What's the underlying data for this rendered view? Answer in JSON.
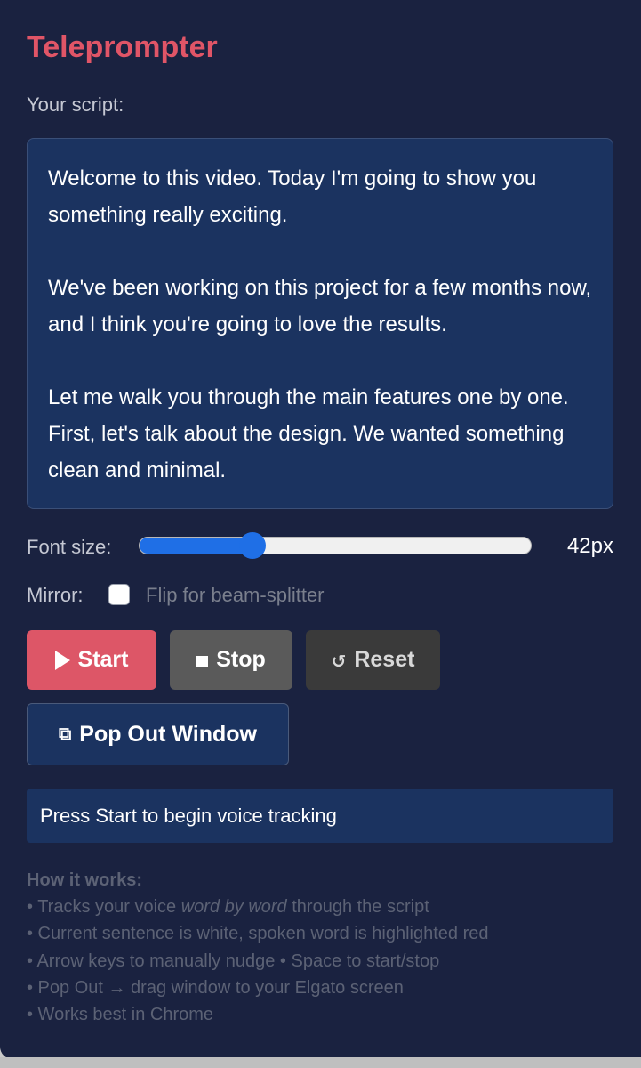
{
  "app": {
    "title": "Teleprompter"
  },
  "script": {
    "label": "Your script:",
    "text": "Welcome to this video. Today I'm going to show you something really exciting.\n\nWe've been working on this project for a few months now, and I think you're going to love the results.\n\nLet me walk you through the main features one by one. First, let's talk about the design. We wanted something clean and minimal."
  },
  "font_size": {
    "label": "Font size:",
    "value_label": "42px",
    "value": 42,
    "slider_fraction": 0.29
  },
  "mirror": {
    "label": "Mirror:",
    "checked": false,
    "hint": "Flip for beam-splitter"
  },
  "buttons": {
    "start": "Start",
    "stop": "Stop",
    "reset": "Reset",
    "popout": "Pop Out Window"
  },
  "icons": {
    "start": "play-icon",
    "stop": "stop-icon",
    "reset": "reset-icon",
    "reset_glyph": "↺",
    "popout": "popout-icon",
    "popout_glyph": "⧉"
  },
  "status": {
    "text": "Press Start to begin voice tracking"
  },
  "how_it_works": {
    "title": "How it works:",
    "lines": [
      {
        "pre": "• Tracks your voice ",
        "em": "word by word",
        "post": " through the script"
      },
      {
        "text": "• Current sentence is white, spoken word is highlighted red"
      },
      {
        "text": "• Arrow keys to manually nudge • Space to start/stop"
      },
      {
        "text": "• Pop Out → drag window to your Elgato screen"
      },
      {
        "text": "• Works best in Chrome"
      }
    ]
  },
  "colors": {
    "background": "#1a2240",
    "accent": "#e05567",
    "start_button": "#dd5667",
    "slider": "#1f6fe6",
    "box": "#1b3360"
  }
}
